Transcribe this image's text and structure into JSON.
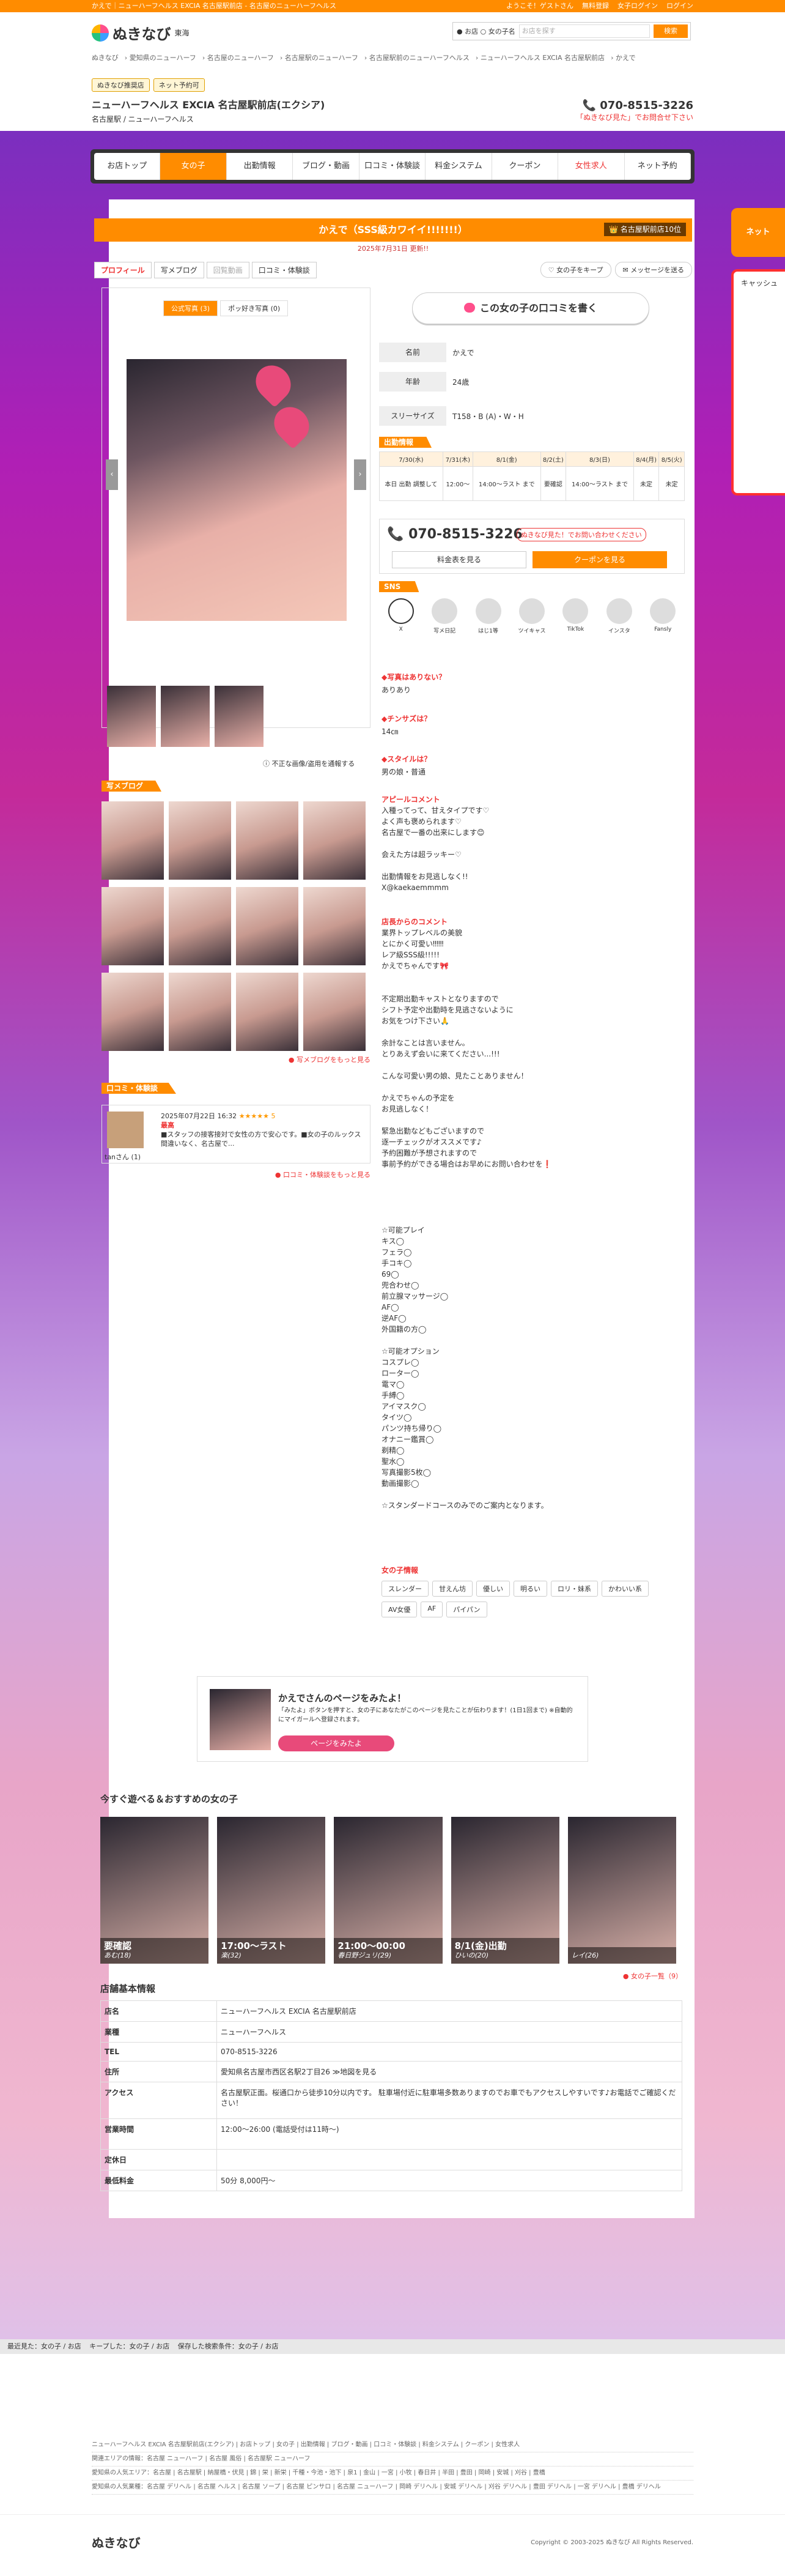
{
  "topbar": {
    "left": "かえで｜ニューハーフヘルス EXCIA 名古屋駅前店 - 名古屋のニューハーフヘルス",
    "greet": "ようこそ！ゲストさん",
    "links": [
      "無料登録",
      "女子ログイン",
      "ログイン"
    ]
  },
  "header": {
    "logo": "ぬきなび",
    "region": "東海",
    "search_opt1": "お店",
    "search_opt2": "女の子名",
    "search_placeholder": "お店を探す",
    "search_btn": "検索"
  },
  "breadcrumb": [
    "ぬきなび",
    "愛知県のニューハーフ",
    "名古屋のニューハーフ",
    "名古屋駅のニューハーフ",
    "名古屋駅前のニューハーフヘルス",
    "ニューハーフヘルス EXCIA 名古屋駅前店",
    "かえで"
  ],
  "shop": {
    "badge1": "ぬきなび推奨店",
    "badge2": "ネット予約可",
    "name": "ニューハーフヘルス EXCIA 名古屋駅前店(エクシア)",
    "type": "名古屋駅 / ニューハーフヘルス",
    "tel": "070-8515-3226",
    "tel_note": "「ぬきなび見た」でお問合せ下さい"
  },
  "nav": [
    "お店トップ",
    "女の子",
    "出勤情報",
    "ブログ・動画",
    "口コミ・体験談",
    "料金システム",
    "クーポン",
    "女性求人",
    "ネット予約"
  ],
  "girl": {
    "title": "かえで（SSS級カワイイ!!!!!!!）",
    "rank": "名古屋駅前店10位",
    "updated": "2025年7月31日 更新!!",
    "tabs": [
      "プロフィール",
      "写メブログ",
      "回覧動画",
      "口コミ・体験談"
    ],
    "keep": "女の子をキープ",
    "msg": "メッセージを送る",
    "photo_tabs": [
      "公式写真 (3)",
      "ポッ好き写真 (0)"
    ],
    "report": "不正な画像/盗用を通報する",
    "kuchi_btn": "この女の子の口コミを書く"
  },
  "profile": [
    {
      "k": "名前",
      "v": "かえで"
    },
    {
      "k": "年齢",
      "v": "24歳"
    },
    {
      "k": "スリーサイズ",
      "v": "T158・B (A)・W・H"
    }
  ],
  "schedule": {
    "title": "出勤情報",
    "days": [
      "7/30(水)",
      "7/31(木)",
      "8/1(金)",
      "8/2(土)",
      "8/3(日)",
      "8/4(月)",
      "8/5(火)"
    ],
    "times": [
      "本日 出勤 調整して",
      "12:00〜",
      "14:00〜ラスト まで",
      "要確認",
      "14:00〜ラスト まで",
      "未定",
      "未定"
    ]
  },
  "telbox": {
    "num": "070-8515-3226",
    "label": "ぬきなび見た！でお問い合わせください",
    "btn1": "料金表を見る",
    "btn2": "クーポンを見る"
  },
  "sns": {
    "title": "SNS",
    "items": [
      "X",
      "写メ日記",
      "はじ1等",
      "ツイキャス",
      "TikTok",
      "インスタ",
      "Fansly"
    ]
  },
  "qa": [
    {
      "q": "◆写真はありない？",
      "a": "ありあり"
    },
    {
      "q": "◆チンサズは？",
      "a": "14㎝"
    },
    {
      "q": "◆スタイルは？",
      "a": "男の娘・普通"
    }
  ],
  "appeal": {
    "t": "アピールコメント",
    "body": "入種ってって、甘えタイプです♡\nよく声も褒められます♡\n名古屋で一番の出来にします😊\n\n会えた方は超ラッキー♡\n\n出勤情報をお見逃しなく!!\nX@kaekaemmmm"
  },
  "staff": {
    "t": "店長からのコメント",
    "body": "業界トップレベルの美貌\nとにかく可愛い‼‼‼\nレア級SSS級!!!!!\nかえでちゃんです🎀\n\n\n不定期出勤キャストとなりますので\nシフト予定や出勤時を見逃さないように\nお気をつけ下さい🙏\n\n余計なことは言いません。\nとりあえず会いに来てください...!!!\n\nこんな可愛い男の娘、見たことありません！\n\nかえでちゃんの予定を\nお見逃しなく！\n\n緊急出勤などもございますので\n逐一チェックがオススメです♪\n予約困難が予想されますので\n事前予約ができる場合はお早めにお問い合わせを❗\n\n\n\n\n\n☆可能プレイ\nキス◯\nフェラ◯\n手コキ◯\n69◯\n兜合わせ◯\n前立腺マッサージ◯\nAF◯\n逆AF◯\n外国籍の方◯\n\n☆可能オプション\nコスプレ◯\nローター◯\n電マ◯\n手縛◯\nアイマスク◯\nタイツ◯\nパンツ持ち帰り◯\nオナニー鑑賞◯\n剃精◯\n聖水◯\n写真撮影5枚◯\n動画撮影◯\n\n☆スタンダードコースのみでのご案内となります。"
  },
  "features": {
    "t": "女の子情報",
    "tags": [
      "スレンダー",
      "甘えん坊",
      "優しい",
      "明るい",
      "ロリ・妹系",
      "かわいい系",
      "AV女優",
      "AF",
      "パイパン"
    ]
  },
  "blog": {
    "t": "写メブログ",
    "more": "写メブログをもっと見る"
  },
  "review": {
    "t": "口コミ・体験談",
    "date": "2025年07月22日 16:32",
    "stars": "★★★★★ 5",
    "rtitle": "最高",
    "body": "■スタッフの接客接対で女性の方で安心です。■女の子のルックス間違いなく、名古屋で...",
    "who": "tanさん (1)",
    "more": "口コミ・体験談をもっと見る"
  },
  "fav": {
    "t1": "かえでさんのページをみたよ！",
    "t2": "「みたよ」ボタンを押すと、女の子にあなたがこのページを見たことが伝わります！(1日1回まで) ※自動的にマイガールへ登録されます。",
    "btn": "ページをみたよ"
  },
  "reco": {
    "t": "今すぐ遊べる＆おすすめの女の子",
    "items": [
      {
        "time": "要確認",
        "name": "あむ(18)"
      },
      {
        "time": "17:00〜ラスト",
        "name": "楽(32)"
      },
      {
        "time": "21:00〜00:00",
        "name": "春日野ジュリ(29)"
      },
      {
        "time": "8/1(金)出勤",
        "name": "ひいの(20)"
      },
      {
        "time": "",
        "name": "レイ(26)"
      }
    ],
    "more": "女の子一覧（9）"
  },
  "shopinfo": {
    "t": "店舗基本情報",
    "rows": [
      {
        "k": "店名",
        "v": "ニューハーフヘルス EXCIA 名古屋駅前店"
      },
      {
        "k": "業種",
        "v": "ニューハーフヘルス"
      },
      {
        "k": "TEL",
        "v": "070-8515-3226"
      },
      {
        "k": "住所",
        "v": "愛知県名古屋市西区名駅2丁目26 ≫地図を見る"
      },
      {
        "k": "アクセス",
        "v": "名古屋駅正面。桜通口から徒歩10分以内です。 駐車場付近に駐車場多数ありますのでお車でもアクセスしやすいです♪お電話でご確認ください！"
      },
      {
        "k": "営業時間",
        "v": "12:00〜26:00 (電話受付は11時〜)"
      },
      {
        "k": "定休日",
        "v": ""
      },
      {
        "k": "最低料金",
        "v": "50分 8,000円〜"
      }
    ]
  },
  "side": {
    "t1": "ネット",
    "t2": "キャッシュ"
  },
  "bottombar": [
    "最近見た：女の子 / お店",
    "キープした：女の子 / お店",
    "保存した検索条件：女の子 / お店"
  ],
  "footer": [
    "ニューハーフヘルス EXCIA 名古屋駅前店(エクシア) | お店トップ | 女の子 | 出勤情報 | ブログ・動画 | 口コミ・体験談 | 料金システム | クーポン | 女性求人",
    "関連エリアの情報：名古屋 ニューハーフ | 名古屋 風俗 | 名古屋駅 ニューハーフ",
    "愛知県の人気エリア：名古屋 | 名古屋駅 | 納屋橋・伏見 | 錦 | 栄 | 新栄 | 千種・今池・池下 | 泉1 | 金山 | 一宮 | 小牧 | 春日井 | 半田 | 豊田 | 岡崎 | 安城 | 刈谷 | 豊橋",
    "愛知県の人気業種：名古屋 デリヘル | 名古屋 ヘルス | 名古屋 ソープ | 名古屋 ピンサロ | 名古屋 ニューハーフ | 岡崎 デリヘル | 安城 デリヘル | 刈谷 デリヘル | 豊田 デリヘル | 一宮 デリヘル | 豊橋 デリヘル"
  ],
  "copyright": "Copyright © 2003-2025 ぬきなび All Rights Reserved."
}
